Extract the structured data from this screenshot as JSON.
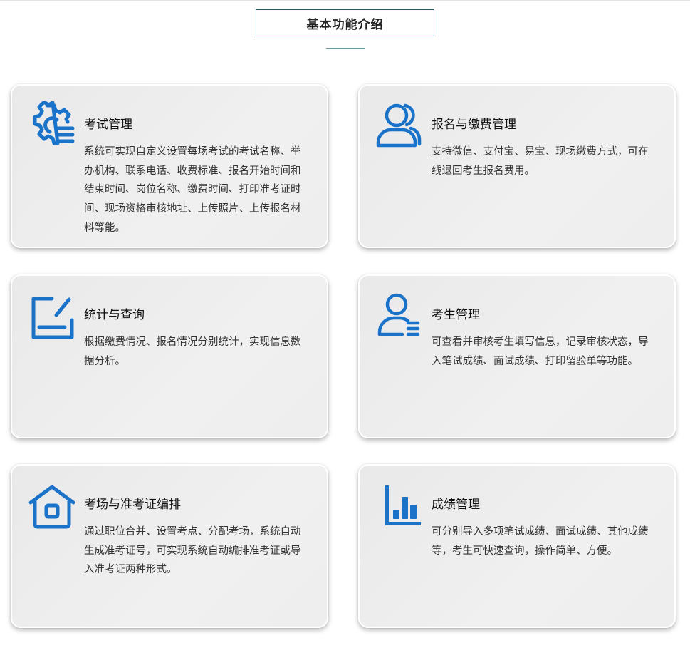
{
  "section": {
    "title": "基本功能介绍"
  },
  "accent_color": "#1a73c9",
  "cards": [
    {
      "icon": "gear-list-icon",
      "title": "考试管理",
      "desc": "系统可实现自定义设置每场考试的考试名称、举办机构、联系电话、收费标准、报名开始时间和结束时间、岗位名称、缴费时间、打印准考证时间、现场资格审核地址、上传照片、上传报名材料等能。"
    },
    {
      "icon": "users-icon",
      "title": "报名与缴费管理",
      "desc": "支持微信、支付宝、易宝、现场缴费方式，可在线退回考生报名费用。"
    },
    {
      "icon": "edit-icon",
      "title": "统计与查询",
      "desc": "根据缴费情况、报名情况分别统计，实现信息数据分析。"
    },
    {
      "icon": "user-list-icon",
      "title": "考生管理",
      "desc": "可查看并审核考生填写信息，记录审核状态，导入笔试成绩、面试成绩、打印留验单等功能。"
    },
    {
      "icon": "home-icon",
      "title": "考场与准考证编排",
      "desc": "通过职位合并、设置考点、分配考场，系统自动生成准考证号，可实现系统自动编排准考证或导入准考证两种形式。"
    },
    {
      "icon": "bar-chart-icon",
      "title": "成绩管理",
      "desc": "可分别导入多项笔试成绩、面试成绩、其他成绩等，考生可快速查询，操作简单、方便。"
    }
  ]
}
